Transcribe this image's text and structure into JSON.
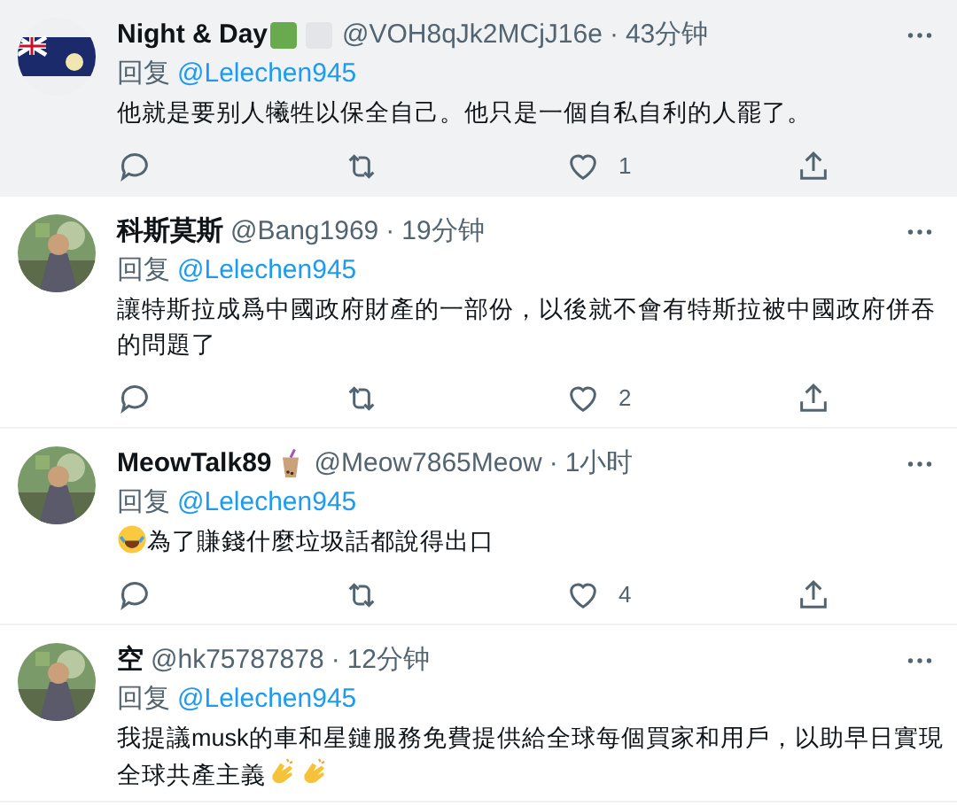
{
  "tweets": [
    {
      "name": "Night & Day",
      "name_badges": [
        {
          "kind": "green-square"
        },
        {
          "kind": "white-square"
        }
      ],
      "handle": "@VOH8qJk2MCjJ16e",
      "separator": "·",
      "time": "43分钟",
      "highlighted": true,
      "reply_label": "回复",
      "reply_to": "@Lelechen945",
      "body_lines": [
        [
          {
            "kind": "text",
            "text": "他就是要别人犧牲以保全自己。他只是一個自私自利的人罷了。"
          }
        ]
      ],
      "like_count": "1"
    },
    {
      "name": "科斯莫斯",
      "handle": "@Bang1969",
      "separator": "·",
      "time": "19分钟",
      "highlighted": false,
      "reply_label": "回复",
      "reply_to": "@Lelechen945",
      "body_lines": [
        [
          {
            "kind": "text",
            "text": "讓特斯拉成爲中國政府財產的一部份，以後就不會有特斯拉被中國政府併吞的問題了"
          }
        ]
      ],
      "like_count": "2"
    },
    {
      "name": "MeowTalk89",
      "name_badges": [
        {
          "kind": "bubble-tea"
        }
      ],
      "handle": "@Meow7865Meow",
      "separator": "·",
      "time": "1小时",
      "highlighted": false,
      "reply_label": "回复",
      "reply_to": "@Lelechen945",
      "body_lines": [
        [
          {
            "kind": "laughing-emoji"
          },
          {
            "kind": "text",
            "text": "為了賺錢什麼垃圾話都說得出口"
          }
        ]
      ],
      "like_count": "4"
    },
    {
      "name": "空",
      "handle": "@hk75787878",
      "separator": "·",
      "time": "12分钟",
      "highlighted": false,
      "reply_label": "回复",
      "reply_to": "@Lelechen945",
      "body_lines": [
        [
          {
            "kind": "text",
            "text": "我提議musk的車和星鏈服務免費提供給全球每個買家和用戶，以助早日實現"
          }
        ],
        [
          {
            "kind": "text",
            "text": "全球共產主義"
          },
          {
            "kind": "clap-emoji"
          },
          {
            "kind": "clap-emoji"
          }
        ]
      ]
    }
  ]
}
